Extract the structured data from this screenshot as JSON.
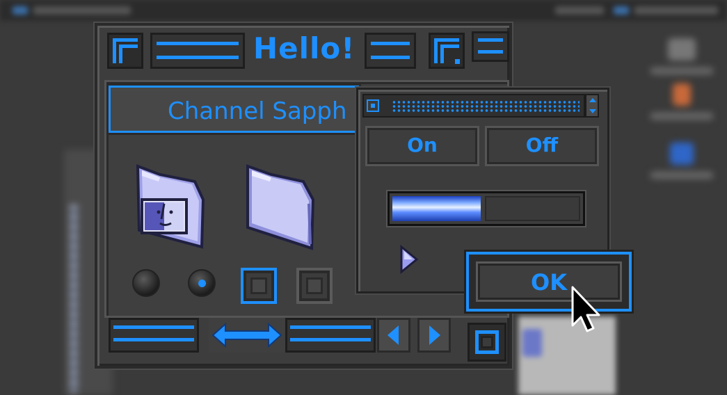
{
  "window": {
    "title": "Hello!",
    "text_field_value": "Channel Sapph"
  },
  "dialog": {
    "on_label": "On",
    "off_label": "Off",
    "progress": 0.47,
    "ok_label": "OK"
  },
  "icons": {
    "folder_1": "finder-folder-icon",
    "folder_2": "folder-icon",
    "cursor": "arrow-pointer-icon"
  },
  "controls": {
    "radio_1_selected": false,
    "radio_2_selected": true,
    "checkbox_1_checked": true,
    "checkbox_2_checked": false
  },
  "colors": {
    "accent": "#1e90ff",
    "window_bg": "#3d3d3d"
  }
}
